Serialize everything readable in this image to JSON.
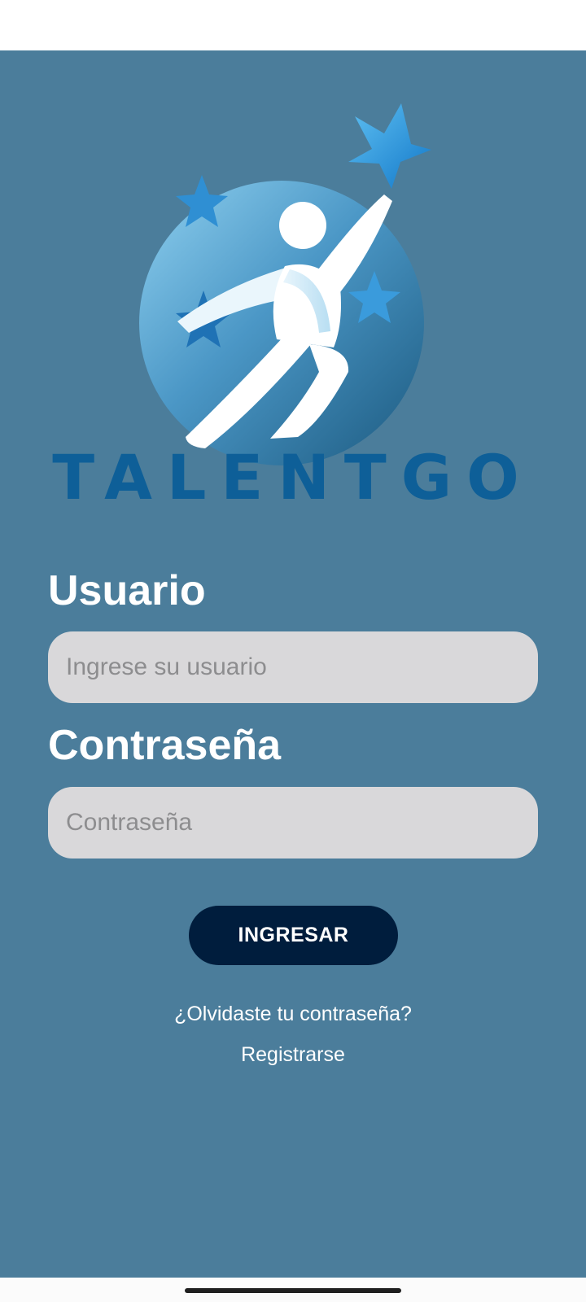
{
  "app": {
    "brand_name": "TALENTGO",
    "logo_icon": "person-reaching-star-icon"
  },
  "login": {
    "username_label": "Usuario",
    "username_placeholder": "Ingrese su usuario",
    "username_value": "",
    "password_label": "Contraseña",
    "password_placeholder": "Contraseña",
    "password_value": "",
    "submit_label": "INGRESAR",
    "forgot_password_label": "¿Olvidaste tu contraseña?",
    "register_label": "Registrarse"
  },
  "colors": {
    "background": "#4b7d9b",
    "input_background": "#d9d8da",
    "button_background": "#001d3d",
    "brand_text": "#0e5f98",
    "text": "#ffffff"
  }
}
